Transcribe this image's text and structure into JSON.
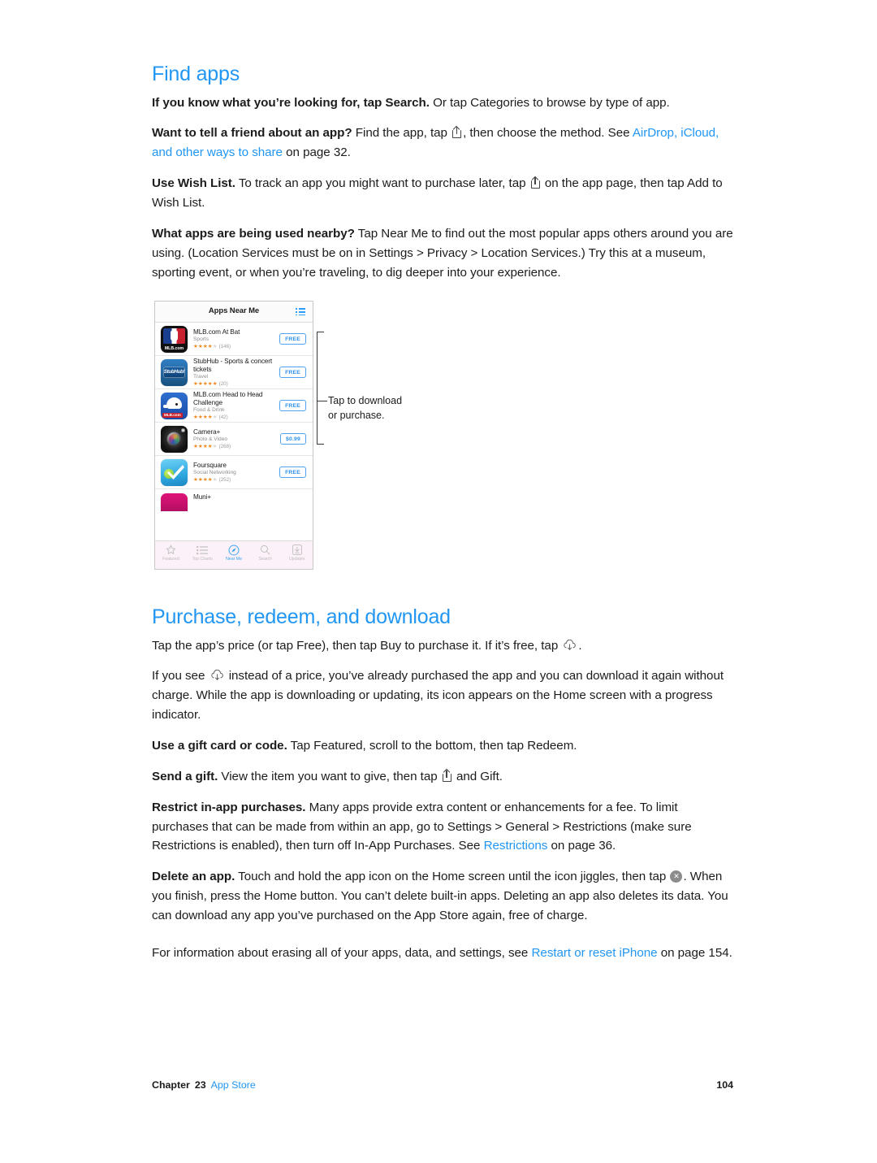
{
  "doc": {
    "sections": [
      {
        "id": "find-apps",
        "title": "Find apps"
      },
      {
        "id": "purchase",
        "title": "Purchase, redeem, and download"
      }
    ]
  },
  "find_apps": {
    "title": "Find apps",
    "p1": {
      "bold": "If you know what you’re looking for, tap Search.",
      "rest": " Or tap Categories to browse by type of app."
    },
    "p2": {
      "bold": "Want to tell a friend about an app?",
      "t1": " Find the app, tap ",
      "t2": ", then choose the method. See ",
      "link": "AirDrop, iCloud, and other ways to share",
      "t3": " on page 32."
    },
    "p3": {
      "bold": "Use Wish List.",
      "t1": " To track an app you might want to purchase later, tap ",
      "t2": " on the app page, then tap Add to Wish List."
    },
    "p4": {
      "bold": "What apps are being used nearby?",
      "rest": "  Tap Near Me to find out the most popular apps others around you are using. (Location Services must be on in Settings > Privacy > Location Services.) Try this at a museum, sporting event, or when you’re traveling, to dig deeper into your experience."
    }
  },
  "figure": {
    "callout_label_line1": "Tap to download",
    "callout_label_line2": "or purchase.",
    "phone": {
      "nav_title": "Apps Near Me",
      "nav_icon": "list-icon",
      "apps": [
        {
          "name": "MLB.com At Bat",
          "category": "Sports",
          "stars": 4,
          "rating_count": "(146)",
          "price": "FREE",
          "icon": "mlb-at-bat-icon",
          "icon_label": "MLB.com"
        },
        {
          "name": "StubHub - Sports & concert tickets",
          "category": "Travel",
          "stars": 5,
          "rating_count": "(20)",
          "price": "FREE",
          "icon": "stubhub-icon",
          "icon_label": "StubHub!"
        },
        {
          "name": "MLB.com Head to Head Challenge",
          "category": "Food & Drink",
          "stars": 4,
          "rating_count": "(42)",
          "price": "FREE",
          "icon": "mlb-head-to-head-icon",
          "icon_label": "MLB.com"
        },
        {
          "name": "Camera+",
          "category": "Photo & Video",
          "stars": 4,
          "rating_count": "(268)",
          "price": "$0.99",
          "icon": "camera-plus-icon",
          "icon_label": ""
        },
        {
          "name": "Foursquare",
          "category": "Social Networking",
          "stars": 4,
          "rating_count": "(252)",
          "price": "FREE",
          "icon": "foursquare-icon",
          "icon_label": ""
        },
        {
          "name": "Muni+",
          "category": "",
          "stars": 0,
          "rating_count": "",
          "price": "",
          "icon": "muni-plus-icon",
          "icon_label": ""
        }
      ],
      "tabs": [
        {
          "label": "Featured",
          "icon": "star-icon",
          "active": false
        },
        {
          "label": "Top Charts",
          "icon": "list-icon",
          "active": false
        },
        {
          "label": "Near Me",
          "icon": "compass-icon",
          "active": true
        },
        {
          "label": "Search",
          "icon": "search-icon",
          "active": false
        },
        {
          "label": "Updates",
          "icon": "download-icon",
          "active": false
        }
      ]
    }
  },
  "purchase": {
    "title": "Purchase, redeem, and download",
    "p1": {
      "t1": "Tap the app’s price (or tap Free), then tap Buy to purchase it. If it’s free, tap ",
      "t2": "."
    },
    "p2": {
      "t1": "If you see ",
      "t2": " instead of a price, you’ve already purchased the app and you can download it again without charge. While the app is downloading or updating, its icon appears on the Home screen with a progress indicator."
    },
    "p3": {
      "bold": "Use a gift card or code.",
      "rest": " Tap Featured, scroll to the bottom, then tap Redeem."
    },
    "p4": {
      "bold": "Send a gift.",
      "t1": " View the item you want to give, then tap ",
      "t2": " and Gift."
    },
    "p5": {
      "bold": "Restrict in-app purchases.",
      "t1": " Many apps provide extra content or enhancements for a fee. To limit purchases that can be made from within an app, go to Settings > General > Restrictions (make sure Restrictions is enabled), then turn off In-App Purchases. See ",
      "link": "Restrictions",
      "t2": " on page 36."
    },
    "p6": {
      "bold": "Delete an app.",
      "t1": " Touch and hold the app icon on the Home screen until the icon jiggles, then tap ",
      "t2": ". When you finish, press the Home button. You can’t delete built-in apps. Deleting an app also deletes its data. You can download any app you’ve purchased on the App Store again, free of charge."
    },
    "p7": {
      "t1": "For information about erasing all of your apps, data, and settings, see ",
      "link": "Restart or reset iPhone",
      "t2": " on page 154."
    }
  },
  "footer": {
    "chapter_label": "Chapter",
    "chapter_number": "23",
    "chapter_title": "App Store",
    "page_number": "104"
  },
  "colors": {
    "accent": "#2196f3",
    "star": "#f08a1e",
    "text": "#1a1a1a",
    "muted": "#8d8d8d"
  }
}
